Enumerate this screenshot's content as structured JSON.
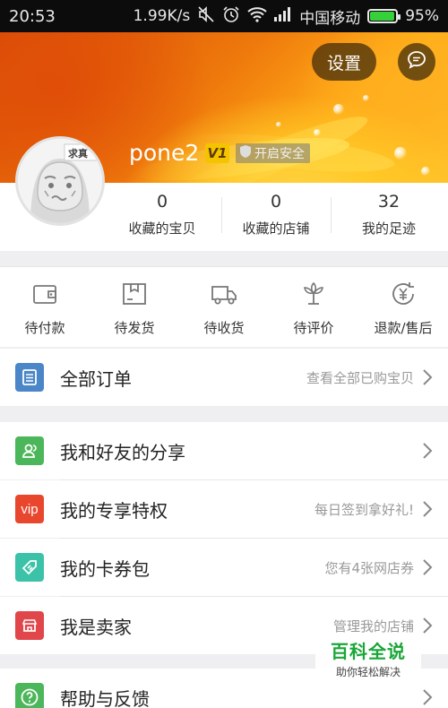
{
  "status_bar": {
    "time": "20:53",
    "speed": "1.99K/s",
    "carrier": "中国移动",
    "battery": "95%",
    "battery_level": 0.95,
    "icons": [
      "mute-icon",
      "alarm-icon",
      "wifi-icon",
      "signal-icon",
      "battery-icon"
    ]
  },
  "header": {
    "settings_label": "设置",
    "message_icon": "chat-bubble-icon",
    "username": "pone2",
    "vip_level": "V1",
    "safety_label": "开启安全",
    "avatar_tag": "求真",
    "colors": {
      "accent": "#ff8a00"
    }
  },
  "stats": [
    {
      "num": "0",
      "label": "收藏的宝贝"
    },
    {
      "num": "0",
      "label": "收藏的店铺"
    },
    {
      "num": "32",
      "label": "我的足迹"
    }
  ],
  "orders": [
    {
      "label": "待付款",
      "icon": "wallet-icon"
    },
    {
      "label": "待发货",
      "icon": "package-icon"
    },
    {
      "label": "待收货",
      "icon": "truck-icon"
    },
    {
      "label": "待评价",
      "icon": "flower-icon"
    },
    {
      "label": "退款/售后",
      "icon": "yuan-return-icon"
    }
  ],
  "all_orders": {
    "label": "全部订单",
    "hint": "查看全部已购宝贝"
  },
  "menu": [
    {
      "label": "我和好友的分享",
      "hint": "",
      "icon": "friend-share-icon",
      "color": "#4cb65a"
    },
    {
      "label": "我的专享特权",
      "hint": "每日签到拿好礼!",
      "icon_text": "vip",
      "color": "#e9462e"
    },
    {
      "label": "我的卡券包",
      "hint": "您有4张网店券",
      "icon": "coupon-icon",
      "color": "#3cc2a8"
    },
    {
      "label": "我是卖家",
      "hint": "管理我的店铺",
      "icon": "shop-icon",
      "color": "#e0464a"
    },
    {
      "label": "帮助与反馈",
      "hint": "",
      "icon": "question-icon",
      "color": "#4cb65a"
    }
  ],
  "watermark": {
    "title": "百科全说",
    "subtitle": "助你轻松解决"
  }
}
